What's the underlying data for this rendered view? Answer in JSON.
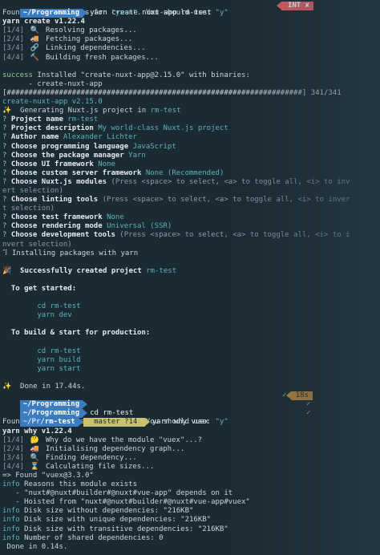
{
  "theme": {
    "background": "#1b2b34",
    "prompt_blue": "#3b7bbf",
    "branch_yellow": "#c9c16e",
    "cyan": "#5fb3b3",
    "green": "#99c794",
    "red_badge": "#ec5f67",
    "time_badge": "#b8863f"
  },
  "session1": {
    "prompt_dir": "~/Programming",
    "command": "yarn create nuxt-app rm-test",
    "int_badge": "INT ✘",
    "alias_prefix": "Found existing alias for ",
    "alias_cmd": "\"yarn\"",
    "alias_mid": ". You should use: ",
    "alias_use": "\"y\"",
    "yarn_version": "yarn create v1.22.4",
    "steps": [
      {
        "num": "[1/4]",
        "icon": "🔍",
        "text": "Resolving packages..."
      },
      {
        "num": "[2/4]",
        "icon": "🚚",
        "text": "Fetching packages..."
      },
      {
        "num": "[3/4]",
        "icon": "🔗",
        "text": "Linking dependencies..."
      },
      {
        "num": "[4/4]",
        "icon": "🔨",
        "text": "Building fresh packages..."
      }
    ],
    "success_label": "success",
    "success_text": " Installed \"create-nuxt-app@2.15.0\" with binaries:",
    "binary": "      - create-nuxt-app",
    "progress_bar": "[####################################################################] 341/341",
    "app_version": "create-nuxt-app v2.15.0",
    "generating_icon": "✨",
    "generating_prefix": "  Generating Nuxt.js project in ",
    "generating_dir": "rm-test"
  },
  "questions": [
    {
      "q": "Project name",
      "a": "rm-test"
    },
    {
      "q": "Project description",
      "a": "My world-class Nuxt.js project"
    },
    {
      "q": "Author name",
      "a": "Alexander Lichter"
    },
    {
      "q": "Choose programming language",
      "a": "JavaScript"
    },
    {
      "q": "Choose the package manager",
      "a": "Yarn"
    },
    {
      "q": "Choose UI framework",
      "a": "None"
    },
    {
      "q": "Choose custom server framework",
      "a": "None (Recommended)"
    }
  ],
  "modules_q": {
    "q": "Choose Nuxt.js modules",
    "hint1": " (Press <space> to select, <a> to toggle all, <i> to inv",
    "hint2": "ert selection)"
  },
  "linting_q": {
    "q": "Choose linting tools",
    "hint1": " (Press <space> to select, <a> to toggle all, <i> to inver",
    "hint2": "t selection)"
  },
  "questions2": [
    {
      "q": "Choose test framework",
      "a": "None"
    },
    {
      "q": "Choose rendering mode",
      "a": "Universal (SSR)"
    }
  ],
  "devtools_q": {
    "q": "Choose development tools",
    "hint1": " (Press <space> to select, <a> to toggle all, <i> to i",
    "hint2": "nvert selection)"
  },
  "installing": "⠹ Installing packages with yarn",
  "created": {
    "icon": "🎉",
    "text": "  Successfully created project ",
    "name": "rm-test"
  },
  "get_started": {
    "heading": "  To get started:",
    "cmd1": "\tcd rm-test",
    "cmd2": "\tyarn dev"
  },
  "build_start": {
    "heading": "  To build & start for production:",
    "cmd1": "\tcd rm-test",
    "cmd2": "\tyarn build",
    "cmd3": "\tyarn start"
  },
  "done": {
    "icon": "✨",
    "text": "  Done in 17.44s."
  },
  "session2": {
    "prompt1_dir": "~/Programming",
    "time": "18s",
    "check": "✓",
    "prompt2_dir": "~/Programming",
    "prompt2_cmd": "cd rm-test",
    "prompt3_dir_prefix": "~/Pr/",
    "prompt3_dir_name": "rm-test",
    "branch": " master ?14 ",
    "command": "yarn why vuex",
    "yarn_version": "yarn why v1.22.4",
    "steps": [
      {
        "num": "[1/4]",
        "icon": "🤔",
        "text": "Why do we have the module \"vuex\"...?"
      },
      {
        "num": "[2/4]",
        "icon": "🚚",
        "text": "Initialising dependency graph..."
      },
      {
        "num": "[3/4]",
        "icon": "🔍",
        "text": "Finding dependency..."
      },
      {
        "num": "[4/4]",
        "icon": "⌛",
        "text": "Calculating file sizes..."
      }
    ],
    "found": "=> Found \"vuex@3.3.0\"",
    "info_label": "info",
    "infos": [
      " Reasons this module exists",
      null,
      null,
      " Disk size without dependencies: \"216KB\"",
      " Disk size with unique dependencies: \"216KB\"",
      " Disk size with transitive dependencies: \"216KB\"",
      " Number of shared dependencies: 0"
    ],
    "reason1": "   - \"nuxt#@nuxt#builder#@nuxt#vue-app\" depends on it",
    "reason2": "   - Hoisted from \"nuxt#@nuxt#builder#@nuxt#vue-app#vuex\"",
    "final": " Done in 0.14s."
  }
}
